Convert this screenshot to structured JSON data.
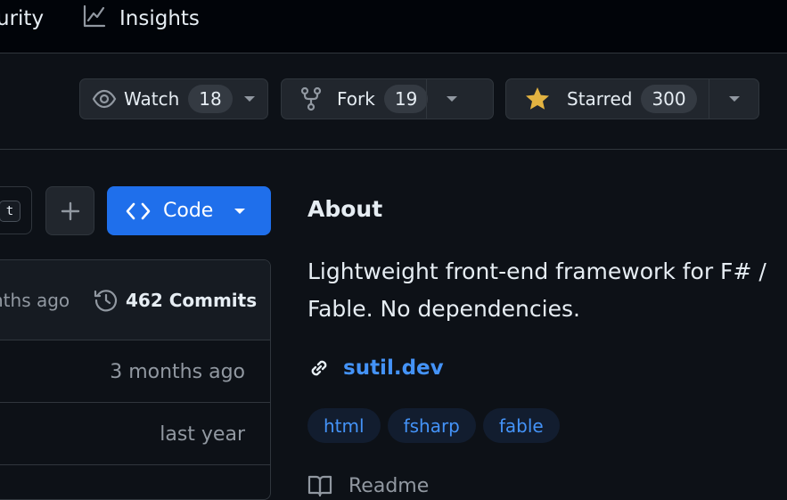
{
  "nav": {
    "security_label": "urity",
    "insights_label": "Insights"
  },
  "actions": {
    "watch": {
      "label": "Watch",
      "count": "18"
    },
    "fork": {
      "label": "Fork",
      "count": "19"
    },
    "star": {
      "label": "Starred",
      "count": "300"
    }
  },
  "toolbar": {
    "kbd_hint": "t",
    "code_label": "Code"
  },
  "files": {
    "header_time": "nths ago",
    "commits_label": "462 Commits",
    "rows": [
      {
        "time": "3 months ago"
      },
      {
        "time": "last year"
      }
    ]
  },
  "about": {
    "title": "About",
    "description": "Lightweight front-end framework for F# / Fable. No dependencies.",
    "link": "sutil.dev",
    "topics": [
      "html",
      "fsharp",
      "fable"
    ],
    "readme_label": "Readme"
  },
  "colors": {
    "background": "#0d1117",
    "accent_blue": "#1f6feb",
    "link_blue": "#4493f8",
    "star_yellow": "#e3b341"
  },
  "icons": [
    "chart-icon",
    "eye-icon",
    "fork-icon",
    "star-icon",
    "plus-icon",
    "code-icon",
    "history-icon",
    "link-icon",
    "book-icon",
    "caret-down-icon"
  ]
}
